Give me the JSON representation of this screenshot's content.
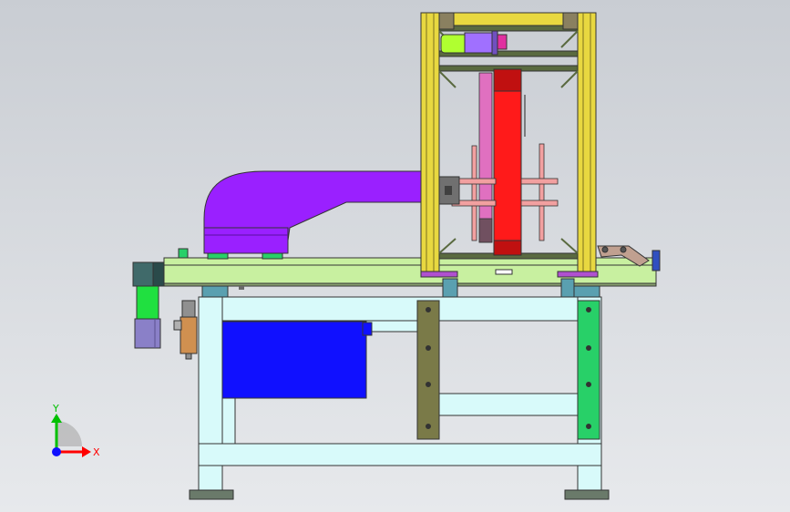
{
  "colors": {
    "bg_top": "#c9cdd3",
    "bg_bottom": "#e7e9ec",
    "frame_cyan": "#d8fafa",
    "frame_olive": "#7a7a48",
    "frame_green": "#28d068",
    "cabinet_blue": "#1010ff",
    "rail_green": "#c8f0a0",
    "tower_yellow": "#e8d840",
    "tower_dark": "#5a6a40",
    "purple_duct": "#9a20ff",
    "red_block": "#ff1a1a",
    "pink": "#f2a0a0",
    "motor_violet": "#a070ff",
    "lime": "#b0ff30",
    "magenta": "#e030a0",
    "cyl_violet": "#8a80c8",
    "cyl_green": "#20e040",
    "teal_box": "#406a6a",
    "filter_orange": "#d09050",
    "axis_red": "#ff0000",
    "axis_green": "#00c000",
    "axis_blue": "#1010ff"
  },
  "triad": {
    "y_label": "Y",
    "x_label": "X"
  }
}
